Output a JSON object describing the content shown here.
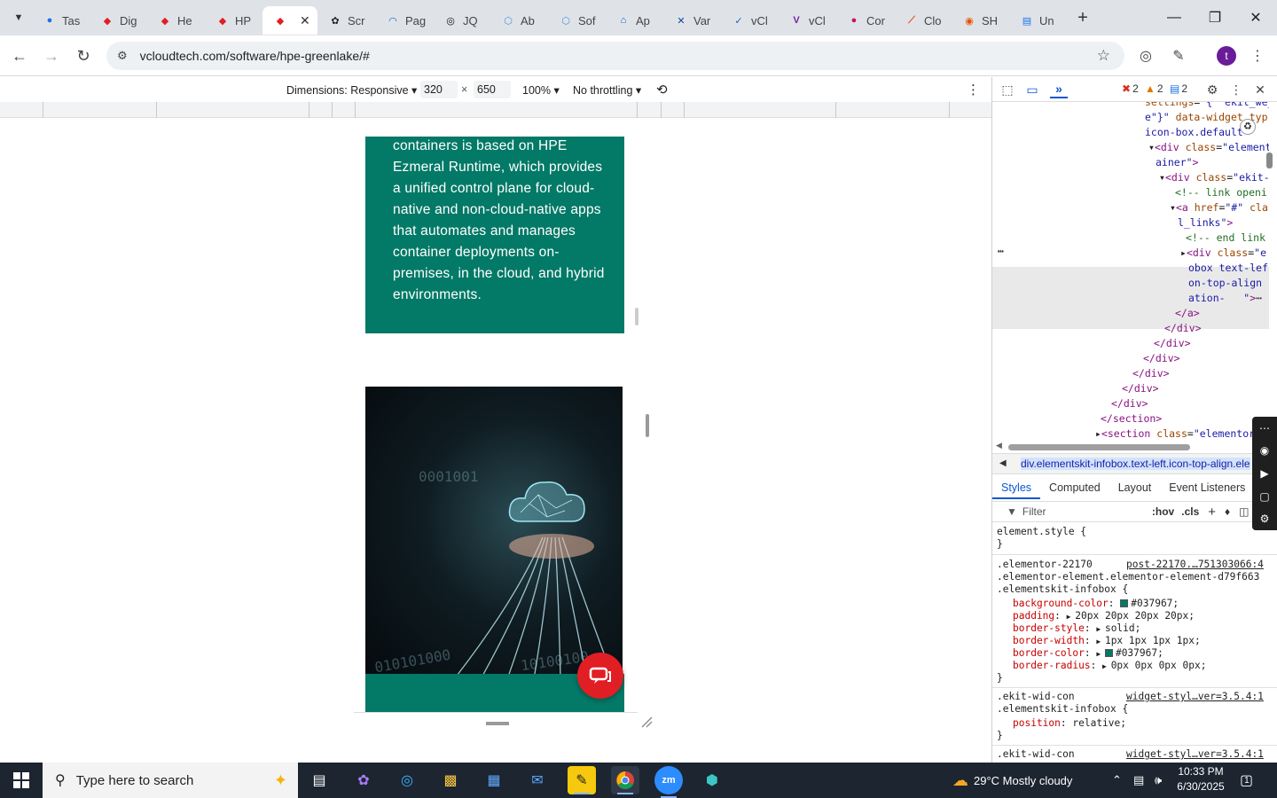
{
  "browser": {
    "tabs": [
      {
        "label": "Tas",
        "fav_color": "#1a73e8",
        "fav_glyph": "●",
        "icon": "tasks-icon"
      },
      {
        "label": "Dig",
        "fav_color": "#e01e24",
        "fav_glyph": "◆",
        "icon": "brand-diamond-icon"
      },
      {
        "label": "He",
        "fav_color": "#e01e24",
        "fav_glyph": "◆",
        "icon": "brand-diamond-icon"
      },
      {
        "label": "HP",
        "fav_color": "#e01e24",
        "fav_glyph": "◆",
        "icon": "brand-diamond-icon"
      },
      {
        "label": "",
        "fav_color": "#e01e24",
        "fav_glyph": "◆",
        "icon": "brand-diamond-icon",
        "active": true
      },
      {
        "label": "Scr",
        "fav_color": "#202124",
        "fav_glyph": "✿",
        "icon": "scr-icon"
      },
      {
        "label": "Pag",
        "fav_color": "#1565c0",
        "fav_glyph": "◠",
        "icon": "pagespeed-icon"
      },
      {
        "label": "JQ",
        "fav_color": "#111",
        "fav_glyph": "◎",
        "icon": "chatgpt-icon"
      },
      {
        "label": "Ab",
        "fav_color": "#4a8fd9",
        "fav_glyph": "⬡",
        "icon": "ab-icon"
      },
      {
        "label": "Sof",
        "fav_color": "#4a8fd9",
        "fav_glyph": "⬡",
        "icon": "sof-icon"
      },
      {
        "label": "Ap",
        "fav_color": "#0b57d0",
        "fav_glyph": "⌂",
        "icon": "app-icon"
      },
      {
        "label": "Var",
        "fav_color": "#0d47a1",
        "fav_glyph": "✕",
        "icon": "var-icon"
      },
      {
        "label": "vCl",
        "fav_color": "#1565c0",
        "fav_glyph": "✓",
        "icon": "vcloud-icon"
      },
      {
        "label": "vCl",
        "fav_color": "#7b1fa2",
        "fav_glyph": "V",
        "icon": "vcloud-icon"
      },
      {
        "label": "Cor",
        "fav_color": "#c2185b",
        "fav_glyph": "●",
        "icon": "cor-icon"
      },
      {
        "label": "Clo",
        "fav_color": "#e64a19",
        "fav_glyph": "⟋",
        "icon": "clo-icon"
      },
      {
        "label": "SH",
        "fav_color": "#e65100",
        "fav_glyph": "◉",
        "icon": "sh-icon"
      },
      {
        "label": "Un",
        "fav_color": "#1a73e8",
        "fav_glyph": "▤",
        "icon": "docs-icon"
      }
    ],
    "url": "vcloudtech.com/software/hpe-greenlake/#",
    "avatar_letter": "t"
  },
  "device_toolbar": {
    "dimensions_label": "Dimensions: Responsive",
    "width": "320",
    "height": "650",
    "times": "×",
    "zoom": "100%",
    "throttling": "No throttling"
  },
  "page": {
    "infobox_text": "containers is based on HPE Ezmeral Runtime, which provides a unified control plane for cloud-native and non-cloud-native apps that automates and manages container deployments on-premises, in the cloud, and hybrid environments.",
    "infobox_color": "#037967",
    "image_digits": [
      "0001001",
      "010101000",
      "10100100"
    ]
  },
  "devtools": {
    "errors": "2",
    "warnings": "2",
    "messages": "2",
    "breadcrumb": "div.elementskit-infobox.text-left.icon-top-align.ele",
    "style_tabs": [
      "Styles",
      "Computed",
      "Layout",
      "Event Listeners"
    ],
    "filter_placeholder": "Filter",
    "hov": ":hov",
    "cls": ".cls",
    "element_style": "element.style {",
    "rule1_source": "post-22170.…751303066:4",
    "rule1_selectors": [
      ".elementor-22170",
      ".elementor-element.elementor-element-d79f663",
      ".elementskit-infobox {"
    ],
    "rule1_props": [
      {
        "name": "background-color",
        "value": "#037967;",
        "swatch": "#037967"
      },
      {
        "name": "padding",
        "value": "20px 20px 20px 20px;"
      },
      {
        "name": "border-style",
        "value": "solid;"
      },
      {
        "name": "border-width",
        "value": "1px 1px 1px 1px;"
      },
      {
        "name": "border-color",
        "value": "#037967;",
        "swatch": "#037967"
      },
      {
        "name": "border-radius",
        "value": "0px 0px 0px 0px;"
      }
    ],
    "rule2_source": "widget-styl…ver=3.5.4:1",
    "rule2_selectors": [
      ".ekit-wid-con",
      ".elementskit-infobox {"
    ],
    "rule2_prop_name": "position",
    "rule2_prop_value": "relative;",
    "rule3_selector": ".ekit-wid-con",
    "rule3_source": "widget-styl…ver=3.5.4:1"
  },
  "taskbar": {
    "search_placeholder": "Type here to search",
    "weather": "29°C  Mostly cloudy",
    "time": "10:33 PM",
    "date": "6/30/2025",
    "notifications": "1"
  }
}
